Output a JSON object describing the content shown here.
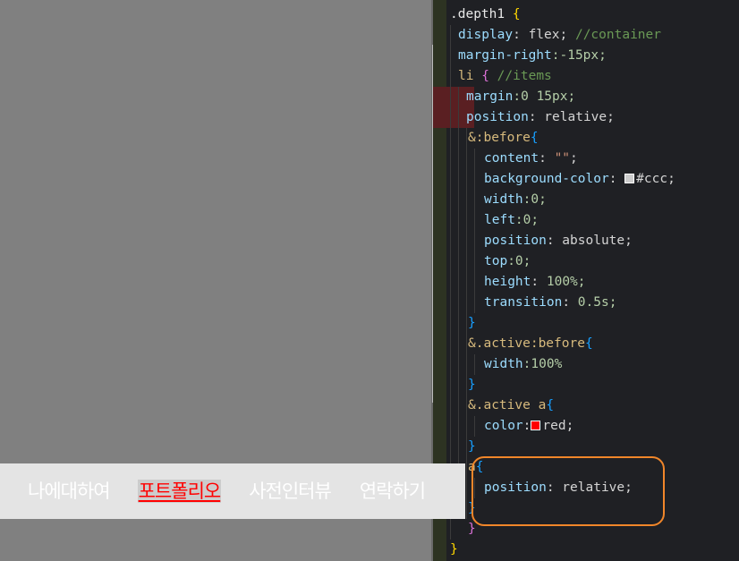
{
  "nav": {
    "items": [
      {
        "label": "나에대하여",
        "active": false
      },
      {
        "label": "포트폴리오",
        "active": true
      },
      {
        "label": "사전인터뷰",
        "active": false
      },
      {
        "label": "연락하기",
        "active": false
      }
    ]
  },
  "code": {
    "l1_sel": ".depth1",
    "l1_brace": " {",
    "l2_prop": "display",
    "l2_val": " flex;",
    "l2_cmt": " //container",
    "l3_prop": "margin-right",
    "l3_val": ":-15px;",
    "l4_sel": "li",
    "l4_brace": " {",
    "l4_cmt": " //items",
    "l5_prop": "margin",
    "l5_val": ":0 15px;",
    "l6_prop": "position",
    "l6_val": " relative;",
    "l7_amp": "&",
    "l7_pseudo": ":before",
    "l7_brace": "{",
    "l8_prop": "content",
    "l8_str": " \"\"",
    "l8_end": ";",
    "l9_prop": "background-color",
    "l9_val": "#ccc;",
    "l10_prop": "width",
    "l10_val": ":0;",
    "l11_prop": "left",
    "l11_val": ":0;",
    "l12_prop": "position",
    "l12_val": " absolute;",
    "l13_prop": "top",
    "l13_val": ":0;",
    "l14_prop": "height",
    "l14_val": " 100%;",
    "l15_prop": "transition",
    "l15_val": " 0.5s;",
    "l16_brace": "}",
    "l17_amp": "&",
    "l17_sel": ".active:before",
    "l17_brace": "{",
    "l18_prop": "width",
    "l18_val": ":100%",
    "l19_brace": "}",
    "l20_amp": "&",
    "l20_sel": ".active a",
    "l20_brace": "{",
    "l21_prop": "color",
    "l21_val": "red;",
    "l22_brace": "}",
    "l23_sel": "a",
    "l23_brace": "{",
    "l24_prop": "position",
    "l24_val": " relative;",
    "l25_brace": "}",
    "l26_brace": "}",
    "l27_brace": "}"
  },
  "colors": {
    "swatch_ccc": "#cccccc",
    "swatch_red": "#ff0000",
    "highlight": "#f0862a"
  }
}
